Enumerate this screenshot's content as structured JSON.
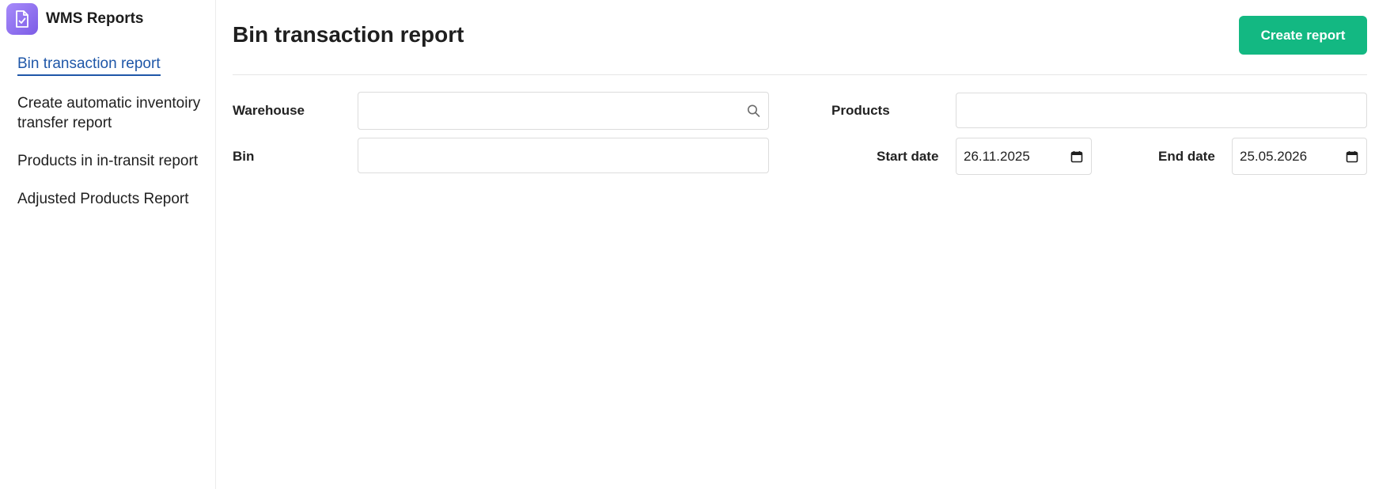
{
  "app": {
    "title": "WMS Reports",
    "brand_color": "#7c5ce6"
  },
  "sidebar": {
    "items": [
      {
        "label": "Bin transaction report",
        "active": true
      },
      {
        "label": "Create automatic inventoiry transfer report",
        "active": false
      },
      {
        "label": "Products in in-transit report",
        "active": false
      },
      {
        "label": "Adjusted Products Report",
        "active": false
      }
    ]
  },
  "main": {
    "title": "Bin transaction report",
    "create_button_label": "Create report",
    "accent_color": "#13b882",
    "form": {
      "warehouse": {
        "label": "Warehouse",
        "value": "",
        "icon": "search-icon"
      },
      "bin": {
        "label": "Bin",
        "value": ""
      },
      "products": {
        "label": "Products",
        "value": ""
      },
      "start_date": {
        "label": "Start date",
        "value": "26.11.2025",
        "icon": "calendar-icon"
      },
      "end_date": {
        "label": "End date",
        "value": "25.05.2026",
        "icon": "calendar-icon"
      }
    }
  }
}
